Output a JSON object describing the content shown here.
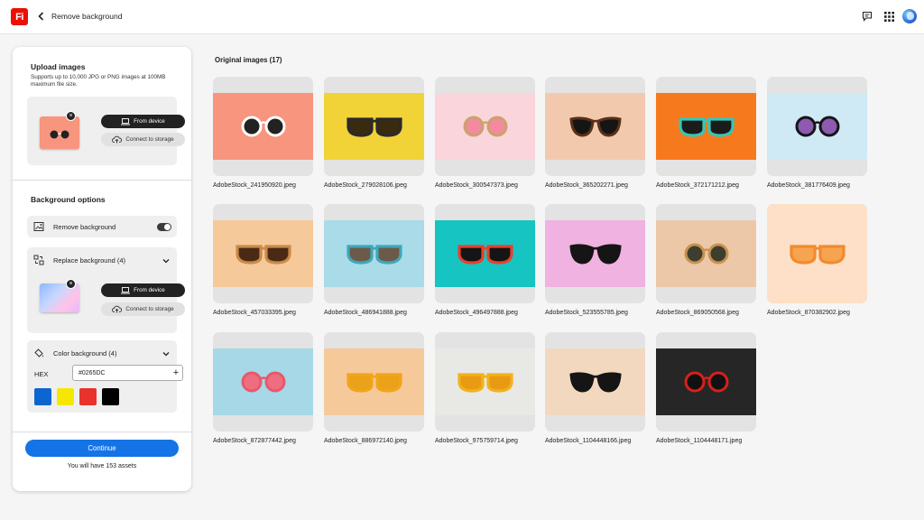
{
  "header": {
    "logo_text": "Fi",
    "title": "Remove background",
    "icons": [
      "back-icon",
      "comment-icon",
      "apps-grid-icon",
      "avatar"
    ]
  },
  "panel": {
    "upload": {
      "title": "Upload images",
      "description": "Supports up to 10,000 JPG or PNG images at 100MB maximum file size.",
      "from_device": "From device",
      "connect_storage": "Connect to storage"
    },
    "background": {
      "title": "Background options",
      "remove_label": "Remove background",
      "remove_enabled": true,
      "replace_label": "Replace background (4)",
      "replace_from_device": "From device",
      "replace_connect_storage": "Connect to storage",
      "color_label": "Color background (4)",
      "hex_label": "HEX",
      "hex_value": "#0265DC",
      "swatches": [
        "#0d66d0",
        "#f5e800",
        "#e8322c",
        "#000000"
      ]
    },
    "continue_label": "Continue",
    "assets_text": "You will have 153 assets"
  },
  "grid": {
    "title": "Original images (17)",
    "images": [
      {
        "name": "AdobeStock_241950920.jpeg",
        "bg": "#f7957e",
        "glasses": "#ffffff",
        "lens": "#222222",
        "shape": "round"
      },
      {
        "name": "AdobeStock_279028106.jpeg",
        "bg": "#f1d338",
        "glasses": "#2a2a2a",
        "lens": "#3a2a10",
        "shape": "wayfarer"
      },
      {
        "name": "AdobeStock_300547373.jpeg",
        "bg": "#fbd5dc",
        "glasses": "#c9a46a",
        "lens": "#f38aa0",
        "shape": "round"
      },
      {
        "name": "AdobeStock_365202271.jpeg",
        "bg": "#f3c9ae",
        "glasses": "#5a3018",
        "lens": "#151515",
        "shape": "cat"
      },
      {
        "name": "AdobeStock_372171212.jpeg",
        "bg": "#f7791e",
        "glasses": "#36c7b5",
        "lens": "#1b1b1b",
        "shape": "wayfarer"
      },
      {
        "name": "AdobeStock_381776409.jpeg",
        "bg": "#cfe9f5",
        "glasses": "#151515",
        "lens": "#8e5ab0",
        "shape": "round"
      },
      {
        "name": "AdobeStock_457033395.jpeg",
        "bg": "#f6c99a",
        "glasses": "#c98a4a",
        "lens": "#4a2a15",
        "shape": "wayfarer"
      },
      {
        "name": "AdobeStock_486941888.jpeg",
        "bg": "#a9dbe8",
        "glasses": "#3fa7b8",
        "lens": "#6b5a4a",
        "shape": "wayfarer"
      },
      {
        "name": "AdobeStock_496497888.jpeg",
        "bg": "#16c4c2",
        "glasses": "#e8402b",
        "lens": "#151515",
        "shape": "wayfarer"
      },
      {
        "name": "AdobeStock_523555785.jpeg",
        "bg": "#f0b2e0",
        "glasses": "#151515",
        "lens": "#151515",
        "shape": "cat"
      },
      {
        "name": "AdobeStock_869050568.jpeg",
        "bg": "#ecc8a8",
        "glasses": "#c8924f",
        "lens": "#3e3e2e",
        "shape": "round"
      },
      {
        "name": "AdobeStock_870382902.jpeg",
        "bg": "#fde0c7",
        "glasses": "#f28a2e",
        "lens": "#f6a450",
        "shape": "wayfarer",
        "full": true
      },
      {
        "name": "AdobeStock_872877442.jpeg",
        "bg": "#a6d8e8",
        "glasses": "#e55a6a",
        "lens": "#f06d80",
        "shape": "round"
      },
      {
        "name": "AdobeStock_886972140.jpeg",
        "bg": "#f6c99a",
        "glasses": "#f2a51a",
        "lens": "#e9a21a",
        "shape": "wayfarer"
      },
      {
        "name": "AdobeStock_975759714.jpeg",
        "bg": "#e8e8e4",
        "glasses": "#f1b21d",
        "lens": "#e89b12",
        "shape": "wayfarer"
      },
      {
        "name": "AdobeStock_1104448166.jpeg",
        "bg": "#f2d8bf",
        "glasses": "#151515",
        "lens": "#151515",
        "shape": "cat"
      },
      {
        "name": "AdobeStock_1104448171.jpeg",
        "bg": "#262626",
        "glasses": "#d6201c",
        "lens": "#111111",
        "shape": "round"
      }
    ]
  }
}
